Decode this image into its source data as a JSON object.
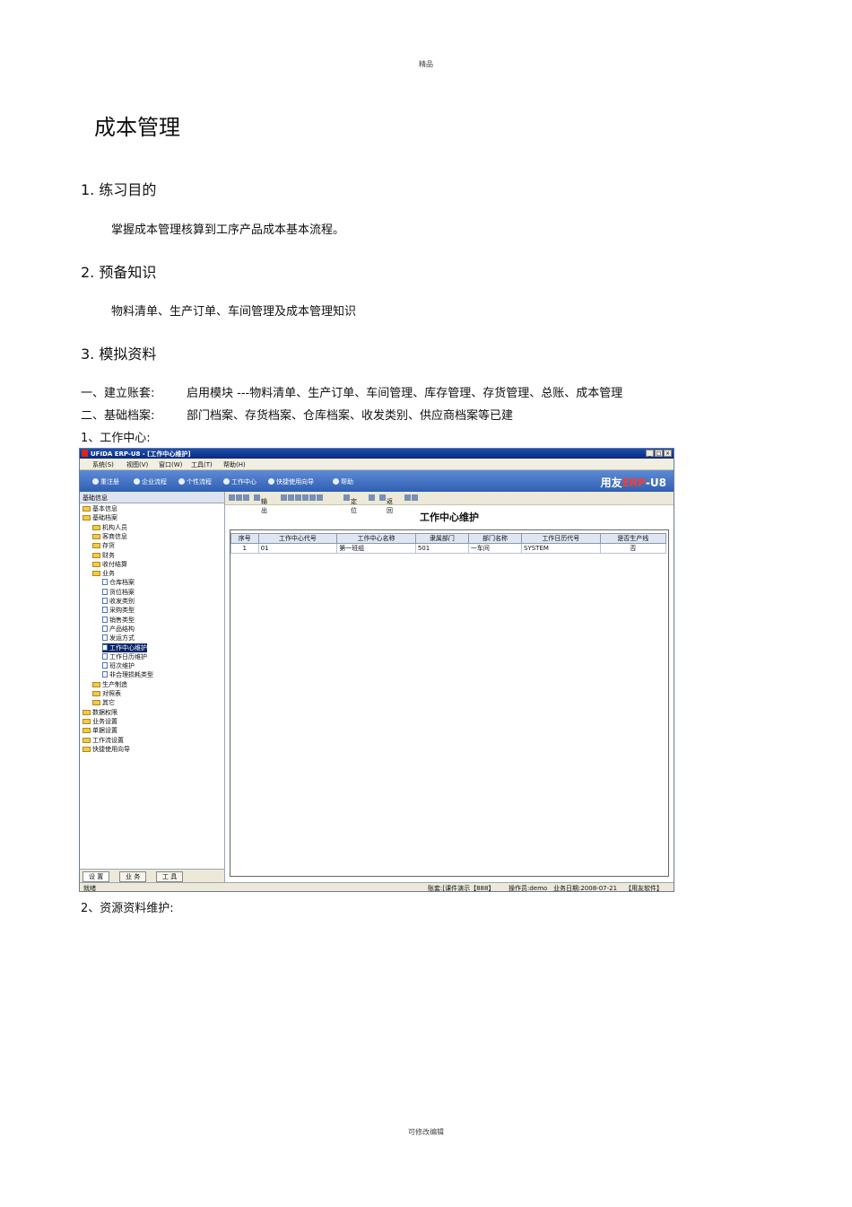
{
  "header_text": "精品",
  "footer_text": "可修改编辑",
  "title": "成本管理",
  "sections": [
    {
      "heading": "1.  练习目的",
      "body": "掌握成本管理核算到工序产品成本基本流程。"
    },
    {
      "heading": "2.  预备知识",
      "body": "物料清单、生产订单、车间管理及成本管理知识"
    },
    {
      "heading": "3.  模拟资料"
    }
  ],
  "data_lines": [
    {
      "label": "一、建立账套:",
      "text": "启用模块 ---物料清单、生产订单、车间管理、库存管理、存货管理、总账、成本管理"
    },
    {
      "label": "二、基础档案:",
      "text": "部门档案、存货档案、仓库档案、收发类别、供应商档案等已建"
    },
    {
      "label": "1、工作中心:",
      "text": ""
    },
    {
      "label": "2、资源资料维护:",
      "text": ""
    }
  ],
  "screenshot": {
    "window_title": "UFIDA ERP-U8 - [工作中心维护]",
    "menus": [
      "系统(S)",
      "视图(V)",
      "窗口(W)",
      "工具(T)",
      "帮助(H)"
    ],
    "quick_links": [
      "重注册",
      "企业流程",
      "个性流程",
      "工作中心",
      "快捷使用向导",
      "帮助"
    ],
    "brand": {
      "prefix": "用友",
      "main": "ERP",
      "suffix": "-U8"
    },
    "left_panel_title": "基础信息",
    "tree": [
      {
        "label": "基本信息",
        "level": 0,
        "type": "folder"
      },
      {
        "label": "基础档案",
        "level": 0,
        "type": "folder"
      },
      {
        "label": "机构人员",
        "level": 1,
        "type": "folder"
      },
      {
        "label": "客商信息",
        "level": 1,
        "type": "folder"
      },
      {
        "label": "存货",
        "level": 1,
        "type": "folder"
      },
      {
        "label": "财务",
        "level": 1,
        "type": "folder"
      },
      {
        "label": "收付结算",
        "level": 1,
        "type": "folder"
      },
      {
        "label": "业务",
        "level": 1,
        "type": "folder"
      },
      {
        "label": "仓库档案",
        "level": 2,
        "type": "doc"
      },
      {
        "label": "货位档案",
        "level": 2,
        "type": "doc"
      },
      {
        "label": "收发类别",
        "level": 2,
        "type": "doc"
      },
      {
        "label": "采购类型",
        "level": 2,
        "type": "doc"
      },
      {
        "label": "销售类型",
        "level": 2,
        "type": "doc"
      },
      {
        "label": "产品结构",
        "level": 2,
        "type": "doc"
      },
      {
        "label": "发运方式",
        "level": 2,
        "type": "doc"
      },
      {
        "label": "工作中心维护",
        "level": 2,
        "type": "doc",
        "selected": true
      },
      {
        "label": "工作日历维护",
        "level": 2,
        "type": "doc"
      },
      {
        "label": "班次维护",
        "level": 2,
        "type": "doc"
      },
      {
        "label": "非合理损耗类型",
        "level": 2,
        "type": "doc"
      },
      {
        "label": "生产制造",
        "level": 1,
        "type": "folder"
      },
      {
        "label": "对照表",
        "level": 1,
        "type": "folder"
      },
      {
        "label": "其它",
        "level": 1,
        "type": "folder"
      },
      {
        "label": "数据权限",
        "level": 0,
        "type": "folder"
      },
      {
        "label": "业务设置",
        "level": 0,
        "type": "folder"
      },
      {
        "label": "单据设置",
        "level": 0,
        "type": "folder"
      },
      {
        "label": "工作流设置",
        "level": 0,
        "type": "folder"
      },
      {
        "label": "快捷使用向导",
        "level": 0,
        "type": "folder"
      }
    ],
    "left_tabs": [
      "设 置",
      "业 务",
      "工 具"
    ],
    "toolbar": [
      "输出",
      "定位",
      "返回"
    ],
    "page_title": "工作中心维护",
    "table": {
      "columns": [
        "序号",
        "工作中心代号",
        "工作中心名称",
        "隶属部门",
        "部门名称",
        "工作日历代号",
        "是否生产线"
      ],
      "rows": [
        [
          "1",
          "01",
          "第一班组",
          "501",
          "一车间",
          "SYSTEM",
          "否"
        ]
      ]
    },
    "status": {
      "left": "就绪",
      "account": "账套:[课件演示【888】",
      "operator": "操作员:demo",
      "date": "业务日期:2008-07-21",
      "vendor": "【用友软件】"
    }
  }
}
